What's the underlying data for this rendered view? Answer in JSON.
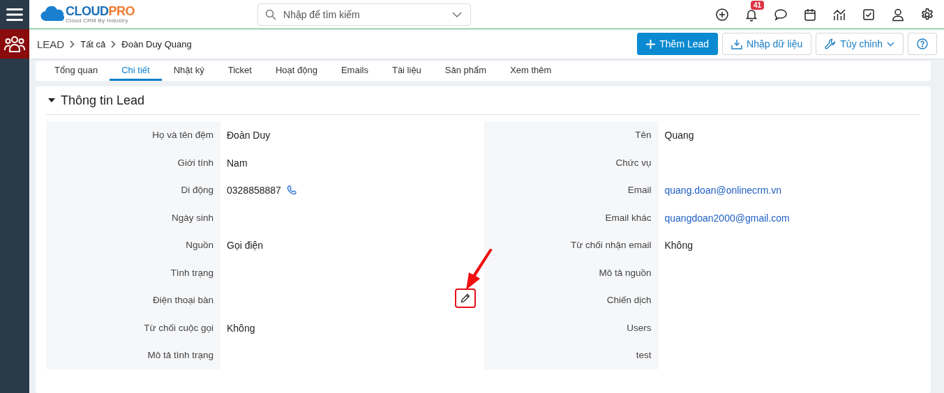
{
  "logo": {
    "brand_left": "CLOUD",
    "brand_right": "PRO",
    "tagline": "Cloud CRM By Industry"
  },
  "search": {
    "placeholder": "Nhập để tìm kiếm"
  },
  "notifications": {
    "count": "41"
  },
  "breadcrumb": [
    "LEAD",
    "Tất cả",
    "Đoàn Duy Quang"
  ],
  "actions": {
    "add": "Thêm Lead",
    "import": "Nhập dữ liệu",
    "customize": "Tùy chỉnh"
  },
  "tabs": [
    {
      "label": "Tổng quan",
      "selected": false
    },
    {
      "label": "Chi tiết",
      "selected": true
    },
    {
      "label": "Nhật ký",
      "selected": false
    },
    {
      "label": "Ticket",
      "selected": false
    },
    {
      "label": "Hoạt động",
      "selected": false
    },
    {
      "label": "Emails",
      "selected": false
    },
    {
      "label": "Tài liệu",
      "selected": false
    },
    {
      "label": "Sản phẩm",
      "selected": false
    },
    {
      "label": "Xem thêm",
      "selected": false
    }
  ],
  "section": {
    "title": "Thông tin Lead",
    "expanded": true
  },
  "fields_left": [
    {
      "label": "Họ và tên đệm",
      "value": "Đoàn Duy",
      "kind": "text",
      "hovered": false
    },
    {
      "label": "Giới tính",
      "value": "Nam",
      "kind": "text",
      "hovered": false
    },
    {
      "label": "Di động",
      "value": "0328858887",
      "kind": "phone",
      "hovered": false
    },
    {
      "label": "Ngày sinh",
      "hovered": false
    },
    {
      "label": "Nguồn",
      "value": "Gọi điện",
      "kind": "text",
      "hovered": false
    },
    {
      "label": "Tình trạng",
      "hovered": false
    },
    {
      "label": "Điện thoại bàn",
      "hovered": true
    },
    {
      "label": "Từ chối cuộc gọi",
      "value": "Không",
      "kind": "text",
      "hovered": false
    },
    {
      "label": "Mô tả tình trạng",
      "hovered": false
    }
  ],
  "fields_right": [
    {
      "label": "Tên",
      "value": "Quang",
      "kind": "text",
      "hovered": false
    },
    {
      "label": "Chức vụ",
      "hovered": false
    },
    {
      "label": "Email",
      "value": "quang.doan@onlinecrm.vn",
      "kind": "email",
      "hovered": false
    },
    {
      "label": "Email khác",
      "value": "quangdoan2000@gmail.com",
      "kind": "email",
      "hovered": false
    },
    {
      "label": "Từ chối nhận email",
      "value": "Không",
      "kind": "text",
      "hovered": false
    },
    {
      "label": "Mô tả nguồn",
      "hovered": false
    },
    {
      "label": "Chiến dịch",
      "hovered": false
    },
    {
      "label": "Users",
      "hovered": false
    },
    {
      "label": "test",
      "hovered": false
    }
  ]
}
